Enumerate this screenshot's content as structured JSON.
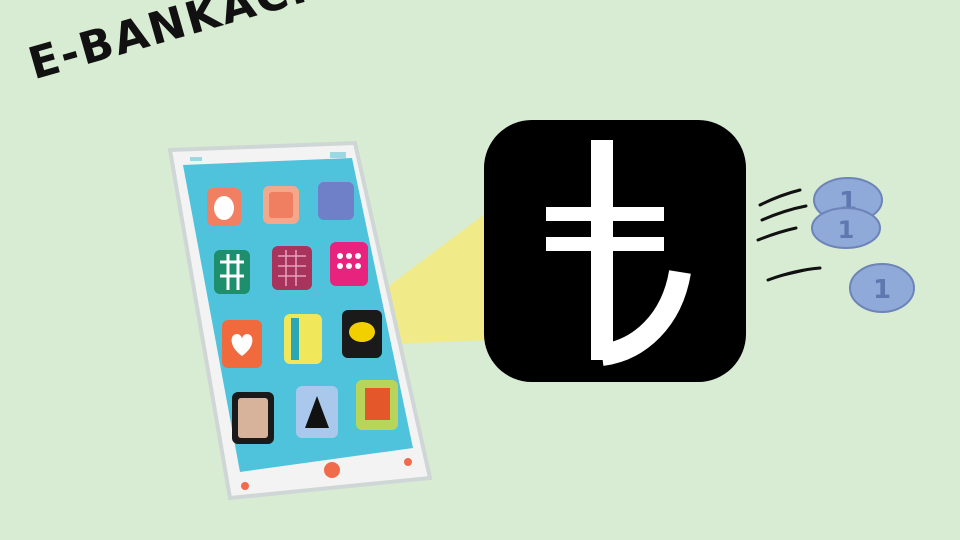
{
  "title": "E-BANKACILIK",
  "colors": {
    "background": "#d8ebd3",
    "phone_body": "#f3f3f3",
    "phone_screen": "#4fc3dc",
    "spotlight": "#f4ea7a",
    "lira_tile": "#000000",
    "lira_symbol": "#ffffff",
    "coin": "#8fa9d8"
  },
  "icons": {
    "phone": "smartphone-icon",
    "lira": "turkish-lira-icon",
    "coins": "coin-icon"
  },
  "coins": {
    "denomination": "1"
  }
}
